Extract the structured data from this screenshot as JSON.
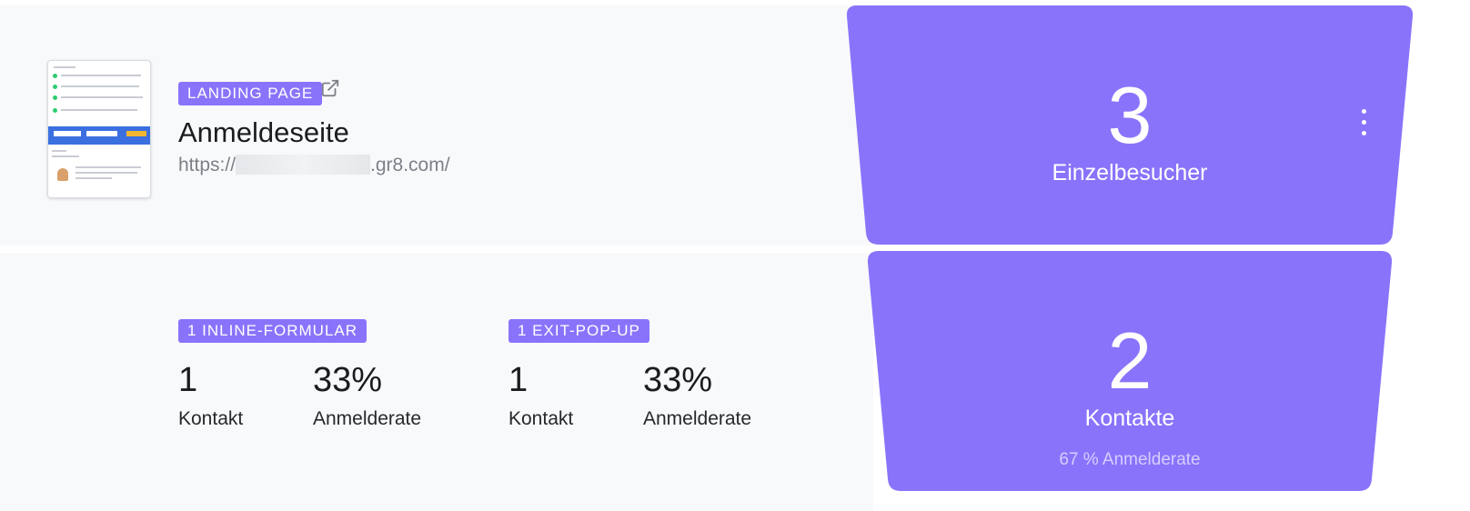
{
  "landing_page": {
    "badge": "LANDING PAGE",
    "title": "Anmeldeseite",
    "url_prefix": "https://",
    "url_suffix": ".gr8.com/"
  },
  "forms": [
    {
      "badge": "1 INLINE-FORMULAR",
      "contacts": "1",
      "contacts_label": "Kontakt",
      "rate": "33%",
      "rate_label": "Anmelderate"
    },
    {
      "badge": "1 EXIT-POP-UP",
      "contacts": "1",
      "contacts_label": "Kontakt",
      "rate": "33%",
      "rate_label": "Anmelderate"
    }
  ],
  "funnel": {
    "visitors": {
      "value": "3",
      "label": "Einzelbesucher"
    },
    "contacts": {
      "value": "2",
      "label": "Kontakte",
      "sub": "67 % Anmelderate"
    }
  },
  "colors": {
    "accent": "#8a73fb",
    "panel": "#f8f9fb"
  },
  "icons": {
    "external": "external-link-icon",
    "menu": "more-vertical-icon"
  }
}
